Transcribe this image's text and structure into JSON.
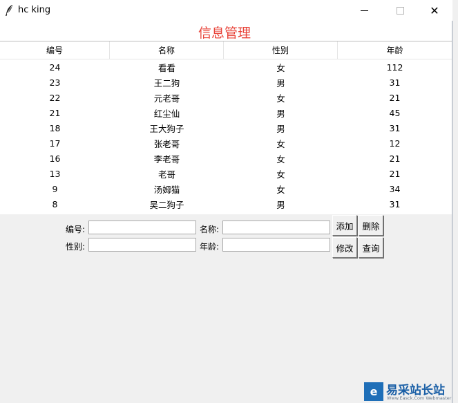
{
  "window": {
    "title": "hc king",
    "controls": {
      "minimize_icon": "minimize-icon",
      "maximize_icon": "maximize-icon",
      "close_icon": "close-icon",
      "close_glyph": "✕"
    }
  },
  "heading": "信息管理",
  "table": {
    "columns": [
      "编号",
      "名称",
      "性别",
      "年龄"
    ],
    "rows": [
      [
        "24",
        "看看",
        "女",
        "112"
      ],
      [
        "23",
        "王二狗",
        "男",
        "31"
      ],
      [
        "22",
        "元老哥",
        "女",
        "21"
      ],
      [
        "21",
        "红尘仙",
        "男",
        "45"
      ],
      [
        "18",
        "王大狗子",
        "男",
        "31"
      ],
      [
        "17",
        "张老哥",
        "女",
        "12"
      ],
      [
        "16",
        "李老哥",
        "女",
        "21"
      ],
      [
        "13",
        "老哥",
        "女",
        "21"
      ],
      [
        "9",
        "汤姆猫",
        "女",
        "34"
      ],
      [
        "8",
        "吴二狗子",
        "男",
        "31"
      ]
    ]
  },
  "form": {
    "id_label": "编号:",
    "name_label": "名称:",
    "gender_label": "性别:",
    "age_label": "年龄:",
    "id_value": "",
    "name_value": "",
    "gender_value": "",
    "age_value": ""
  },
  "buttons": {
    "add": "添加",
    "delete": "删除",
    "edit": "修改",
    "query": "查询"
  },
  "watermark": {
    "logo_glyph": "e",
    "text": "易采站长站",
    "subtext": "Www.Easck.Com Webmaster"
  },
  "colors": {
    "heading": "#e8443a",
    "watermark": "#1a5fa6"
  }
}
